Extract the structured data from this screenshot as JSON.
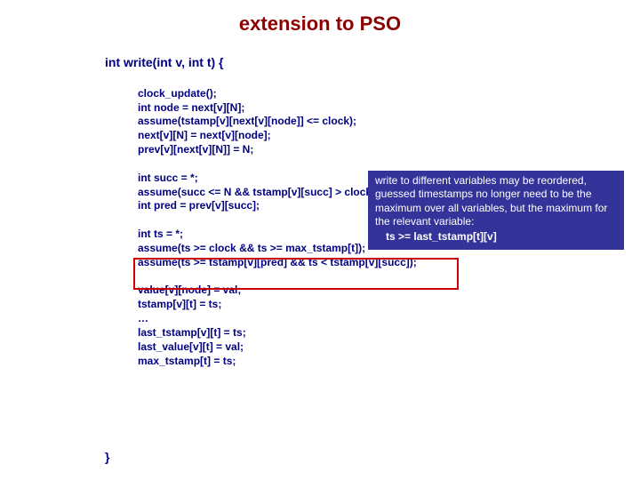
{
  "title": "extension to PSO",
  "signature": "int write(int v, int t) {",
  "closeBrace": "}",
  "block1": "clock_update();\nint node = next[v][N];\nassume(tstamp[v][next[v][node]] <= clock);\nnext[v][N] = next[v][node];\nprev[v][next[v][N]] = N;",
  "block2": "int succ = *;\nassume(succ <= N && tstamp[v][succ] > clock);\nint pred = prev[v][succ];",
  "block3": "int ts = *;\nassume(ts >= clock && ts >= max_tstamp[t]);\nassume(ts >= tstamp[v][pred] && ts < tstamp[v][succ]);",
  "block4": "value[v][node] = val;\ntstamp[v][t] = ts;\n…\nlast_tstamp[v][t] = ts;\nlast_value[v][t] = val;\nmax_tstamp[t] = ts;",
  "callout": {
    "text": "write to different variables may be reordered, guessed timestamps no longer need to be the maximum over all variables, but the maximum for the relevant variable:",
    "ts": "ts >= last_tstamp[t][v]"
  }
}
